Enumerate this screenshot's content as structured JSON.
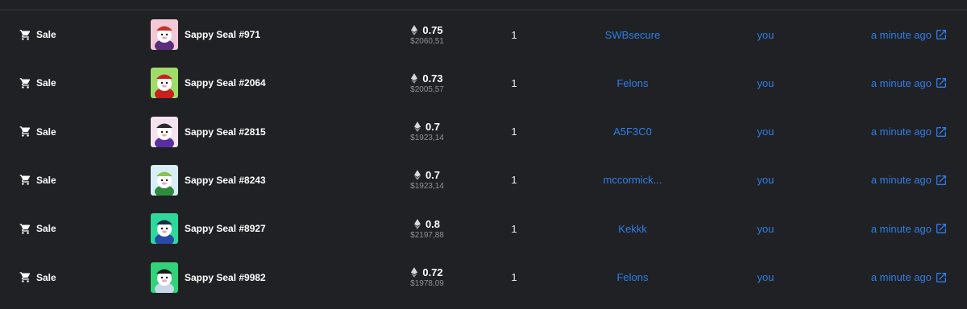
{
  "colors": {
    "background": "#202124",
    "link": "#2f7de9",
    "muted": "#8d9196"
  },
  "icons": {
    "event": "cart-icon",
    "currency": "ethereum-icon",
    "external": "external-link-icon"
  },
  "rows": [
    {
      "event": "Sale",
      "name": "Sappy Seal #971",
      "price_eth": "0.75",
      "price_usd": "$2060,51",
      "quantity": "1",
      "from": "SWBsecure",
      "to": "you",
      "time": "a minute ago",
      "thumb_bg": "#f3c9d6",
      "hat": "#c8302c",
      "coat": "#5a2e7a"
    },
    {
      "event": "Sale",
      "name": "Sappy Seal #2064",
      "price_eth": "0.73",
      "price_usd": "$2005,57",
      "quantity": "1",
      "from": "Felons",
      "to": "you",
      "time": "a minute ago",
      "thumb_bg": "#9fdc6a",
      "hat": "#d01f1f",
      "coat": "#c81f1f"
    },
    {
      "event": "Sale",
      "name": "Sappy Seal #2815",
      "price_eth": "0.7",
      "price_usd": "$1923,14",
      "quantity": "1",
      "from": "A5F3C0",
      "to": "you",
      "time": "a minute ago",
      "thumb_bg": "#f5e2ee",
      "hat": "#2a2a2a",
      "coat": "#5a2ea0"
    },
    {
      "event": "Sale",
      "name": "Sappy Seal #8243",
      "price_eth": "0.7",
      "price_usd": "$1923,14",
      "quantity": "1",
      "from": "mccormick...",
      "to": "you",
      "time": "a minute ago",
      "thumb_bg": "#d7eef7",
      "hat": "#8bc34a",
      "coat": "#2e8b3e"
    },
    {
      "event": "Sale",
      "name": "Sappy Seal #8927",
      "price_eth": "0.8",
      "price_usd": "$2197,88",
      "quantity": "1",
      "from": "Kekkk",
      "to": "you",
      "time": "a minute ago",
      "thumb_bg": "#2fd89a",
      "hat": "#1e2a44",
      "coat": "#2a4aa8"
    },
    {
      "event": "Sale",
      "name": "Sappy Seal #9982",
      "price_eth": "0.72",
      "price_usd": "$1978,09",
      "quantity": "1",
      "from": "Felons",
      "to": "you",
      "time": "a minute ago",
      "thumb_bg": "#33d17a",
      "hat": "#1a1a1a",
      "coat": "#c8d8e8"
    }
  ]
}
